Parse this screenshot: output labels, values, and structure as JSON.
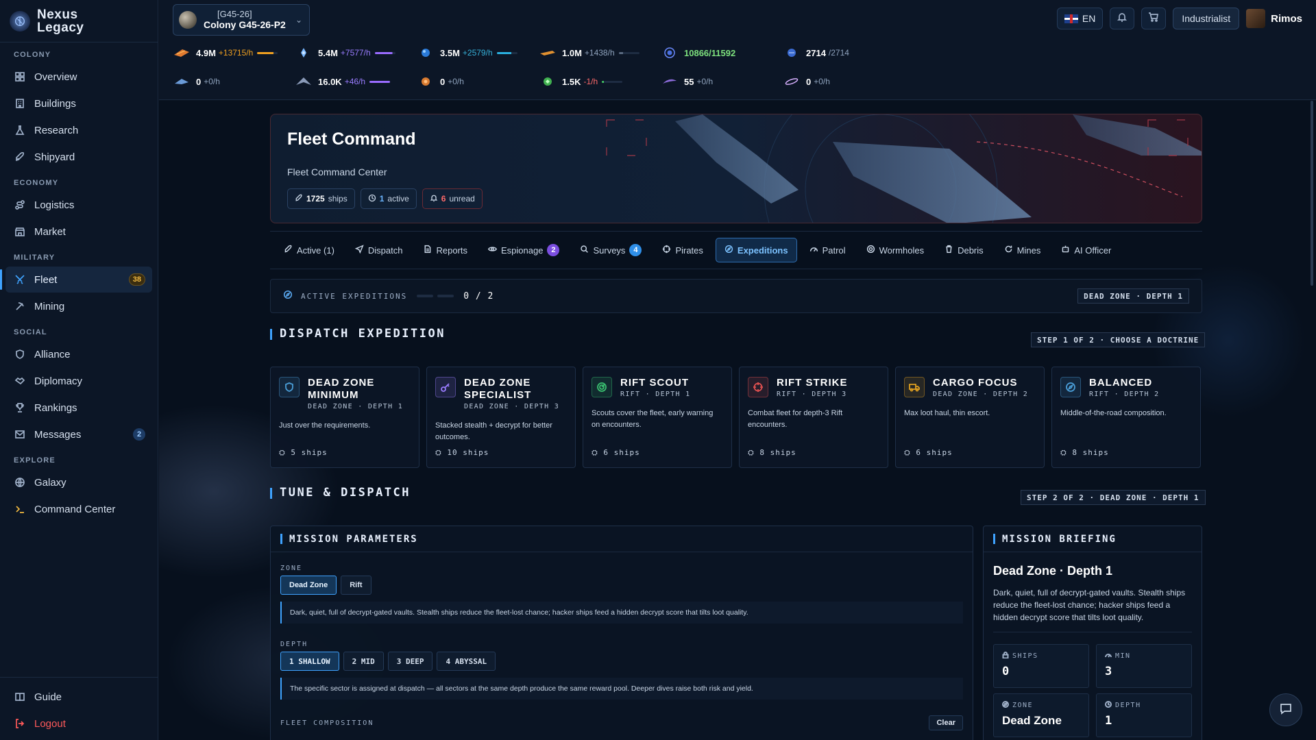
{
  "app": {
    "name_line1": "Nexus",
    "name_line2": "Legacy"
  },
  "colony": {
    "code": "[G45-26]",
    "name": "Colony G45-26-P2"
  },
  "topbar": {
    "lang": "EN",
    "role": "Industrialist",
    "user": "Rimos"
  },
  "resources_row1": [
    {
      "amount": "4.9M",
      "rate": "+13715/h",
      "bar_color": "#f0a020",
      "bar_fill": 0.8,
      "rate_color": "#f0a020"
    },
    {
      "amount": "5.4M",
      "rate": "+7577/h",
      "bar_color": "#9a6cff",
      "bar_fill": 0.85,
      "rate_color": "#9a7cff"
    },
    {
      "amount": "3.5M",
      "rate": "+2579/h",
      "bar_color": "#2ab0e0",
      "bar_fill": 0.7,
      "rate_color": "#36b0d8"
    },
    {
      "amount": "1.0M",
      "rate": "+1438/h",
      "bar_color": "#5a6a80",
      "bar_fill": 0.2,
      "rate_color": "#8fa3bd"
    },
    {
      "amount": "10866/11592",
      "rate": "",
      "bar_color": "",
      "bar_fill": 0,
      "rate_color": "#8fa3bd",
      "amount_color": "#7de07d"
    },
    {
      "amount": "2714",
      "rate": "/2714",
      "bar_color": "",
      "bar_fill": 0,
      "rate_color": "#8fa3bd"
    }
  ],
  "resources_row2": [
    {
      "amount": "0",
      "rate": "+0/h",
      "bar_color": "",
      "bar_fill": 0,
      "rate_color": "#8fa3bd"
    },
    {
      "amount": "16.0K",
      "rate": "+46/h",
      "bar_color": "#9a6cff",
      "bar_fill": 1.0,
      "rate_color": "#9a7cff"
    },
    {
      "amount": "0",
      "rate": "+0/h",
      "bar_color": "",
      "bar_fill": 0,
      "rate_color": "#8fa3bd"
    },
    {
      "amount": "1.5K",
      "rate": "-1/h",
      "bar_color": "#40c060",
      "bar_fill": 0.1,
      "rate_color": "#ff6a6a"
    },
    {
      "amount": "55",
      "rate": "+0/h",
      "bar_color": "",
      "bar_fill": 0,
      "rate_color": "#8fa3bd"
    },
    {
      "amount": "0",
      "rate": "+0/h",
      "bar_color": "",
      "bar_fill": 0,
      "rate_color": "#8fa3bd"
    }
  ],
  "sidebar": {
    "sections": {
      "colony": "COLONY",
      "economy": "ECONOMY",
      "military": "MILITARY",
      "social": "SOCIAL",
      "explore": "EXPLORE"
    },
    "items": {
      "overview": "Overview",
      "buildings": "Buildings",
      "research": "Research",
      "shipyard": "Shipyard",
      "logistics": "Logistics",
      "market": "Market",
      "fleet": "Fleet",
      "fleet_badge": "38",
      "mining": "Mining",
      "alliance": "Alliance",
      "diplomacy": "Diplomacy",
      "rankings": "Rankings",
      "messages": "Messages",
      "messages_badge": "2",
      "galaxy": "Galaxy",
      "command_center": "Command Center",
      "guide": "Guide",
      "logout": "Logout"
    }
  },
  "hero": {
    "title": "Fleet Command",
    "subtitle": "Fleet Command Center",
    "ships_count": "1725",
    "ships_label": "ships",
    "active_count": "1",
    "active_label": "active",
    "unread_count": "6",
    "unread_label": "unread"
  },
  "tabs": {
    "active": "Active (1)",
    "dispatch": "Dispatch",
    "reports": "Reports",
    "espionage": "Espionage",
    "espionage_badge": "2",
    "surveys": "Surveys",
    "surveys_badge": "4",
    "pirates": "Pirates",
    "expeditions": "Expeditions",
    "patrol": "Patrol",
    "wormholes": "Wormholes",
    "debris": "Debris",
    "mines": "Mines",
    "ai_officer": "AI Officer"
  },
  "active_expeditions": {
    "label": "ACTIVE EXPEDITIONS",
    "count": "0 / 2",
    "fill": 0,
    "tag": "DEAD ZONE · DEPTH 1"
  },
  "dispatch": {
    "title": "DISPATCH EXPEDITION",
    "step": "STEP 1 OF 2 · CHOOSE A DOCTRINE"
  },
  "doctrines": [
    {
      "name": "DEAD ZONE MINIMUM",
      "meta": "DEAD ZONE · DEPTH 1",
      "desc": "Just over the requirements.",
      "ships": "5 ships",
      "color": "#4a9ed8",
      "icon": "shield-icon"
    },
    {
      "name": "DEAD ZONE SPECIALIST",
      "meta": "DEAD ZONE · DEPTH 3",
      "desc": "Stacked stealth + decrypt for better outcomes.",
      "ships": "10 ships",
      "color": "#9a7cff",
      "icon": "key-icon"
    },
    {
      "name": "RIFT SCOUT",
      "meta": "RIFT · DEPTH 1",
      "desc": "Scouts cover the fleet, early warning on encounters.",
      "ships": "6 ships",
      "color": "#3ac070",
      "icon": "radar-icon"
    },
    {
      "name": "RIFT STRIKE",
      "meta": "RIFT · DEPTH 3",
      "desc": "Combat fleet for depth-3 Rift encounters.",
      "ships": "8 ships",
      "color": "#e05050",
      "icon": "crosshair-icon"
    },
    {
      "name": "CARGO FOCUS",
      "meta": "DEAD ZONE · DEPTH 2",
      "desc": "Max loot haul, thin escort.",
      "ships": "6 ships",
      "color": "#e0a020",
      "icon": "truck-icon"
    },
    {
      "name": "BALANCED",
      "meta": "RIFT · DEPTH 2",
      "desc": "Middle-of-the-road composition.",
      "ships": "8 ships",
      "color": "#4a9ed8",
      "icon": "compass-icon"
    }
  ],
  "tune": {
    "title": "TUNE & DISPATCH",
    "step": "STEP 2 OF 2 · DEAD ZONE · DEPTH 1"
  },
  "params": {
    "title": "MISSION PARAMETERS",
    "zone_label": "ZONE",
    "zones": [
      "Dead Zone",
      "Rift"
    ],
    "zone_note": "Dark, quiet, full of decrypt-gated vaults. Stealth ships reduce the fleet-lost chance; hacker ships feed a hidden decrypt score that tilts loot quality.",
    "depth_label": "DEPTH",
    "depths": [
      "1 SHALLOW",
      "2 MID",
      "3 DEEP",
      "4 ABYSSAL"
    ],
    "depth_note": "The specific sector is assigned at dispatch — all sectors at the same depth produce the same reward pool. Deeper dives raise both risk and yield.",
    "fleet_label": "FLEET COMPOSITION",
    "clear": "Clear"
  },
  "briefing": {
    "title": "MISSION BRIEFING",
    "heading": "Dead Zone · Depth 1",
    "desc": "Dark, quiet, full of decrypt-gated vaults. Stealth ships reduce the fleet-lost chance; hacker ships feed a hidden decrypt score that tilts loot quality.",
    "ships_label": "SHIPS",
    "ships_value": "0",
    "min_label": "MIN",
    "min_value": "3",
    "zone_label": "ZONE",
    "zone_value": "Dead Zone",
    "depth_label": "DEPTH",
    "depth_value": "1"
  }
}
